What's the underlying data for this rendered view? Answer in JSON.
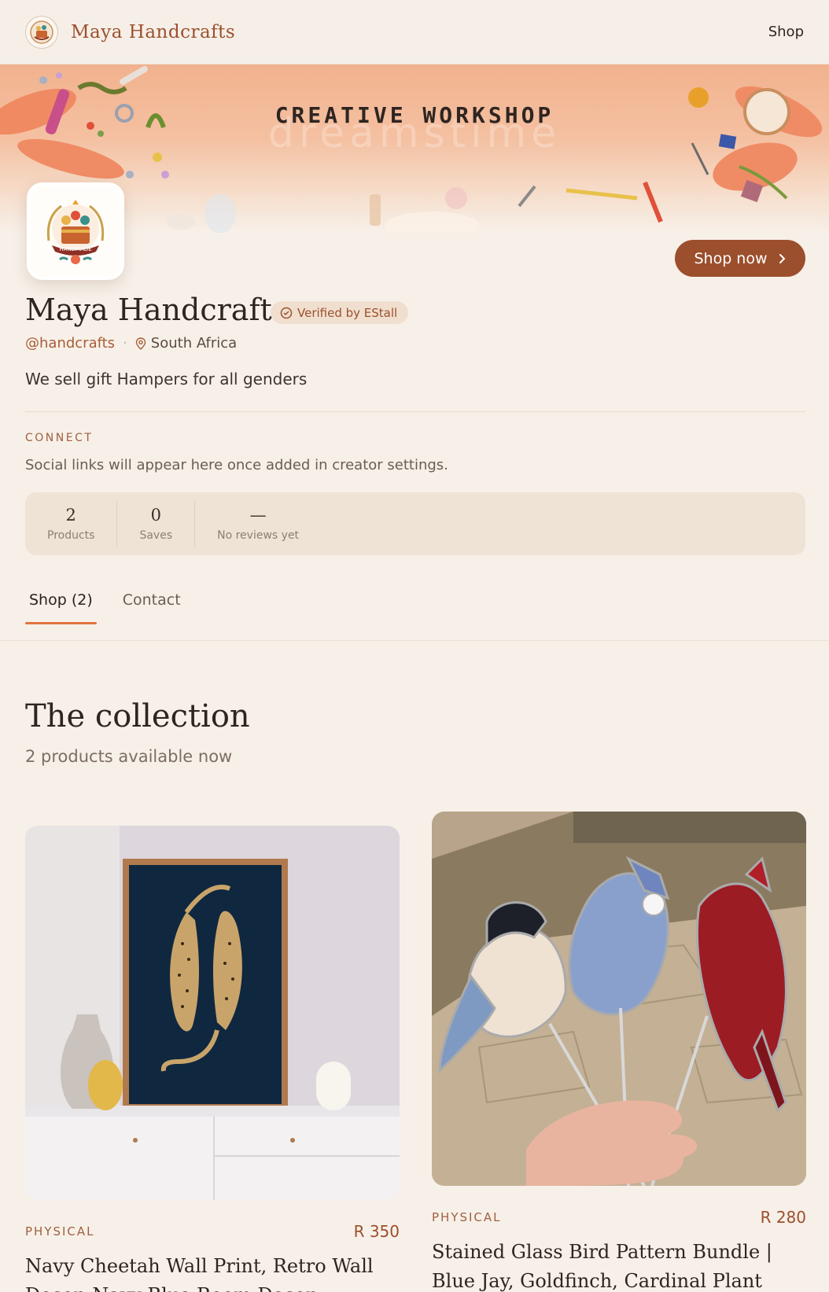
{
  "nav": {
    "brand": "Maya Handcrafts",
    "shop_link": "Shop"
  },
  "banner": {
    "headline": "CREATIVE WORKSHOP",
    "watermark": "dreamstime"
  },
  "avatar": {
    "badge_text": "HANDMADE"
  },
  "profile": {
    "name": "Maya Handcrafts",
    "verified_label": "Verified by EStall",
    "handle": "@handcrafts",
    "location": "South Africa",
    "bio": "We sell gift Hampers for all genders",
    "shop_now_label": "Shop now"
  },
  "connect": {
    "label": "CONNECT",
    "note": "Social links will appear here once added in creator settings."
  },
  "stats": [
    {
      "value": "2",
      "label": "Products"
    },
    {
      "value": "0",
      "label": "Saves"
    },
    {
      "value": "—",
      "label": "No reviews yet"
    }
  ],
  "tabs": [
    {
      "label": "Shop (2)",
      "active": true
    },
    {
      "label": "Contact",
      "active": false
    }
  ],
  "collection": {
    "title": "The collection",
    "subtitle": "2 products available now"
  },
  "products": [
    {
      "type": "PHYSICAL",
      "price": "R 350",
      "name": "Navy Cheetah Wall Print, Retro Wall Decor, Navy Blue Room Decor"
    },
    {
      "type": "PHYSICAL",
      "price": "R 280",
      "name": "Stained Glass Bird Pattern Bundle | Blue Jay, Goldfinch, Cardinal Plant"
    }
  ],
  "colors": {
    "accent": "#9c4f2c",
    "tab_underline": "#e0733f",
    "background": "#f7f0e9"
  }
}
